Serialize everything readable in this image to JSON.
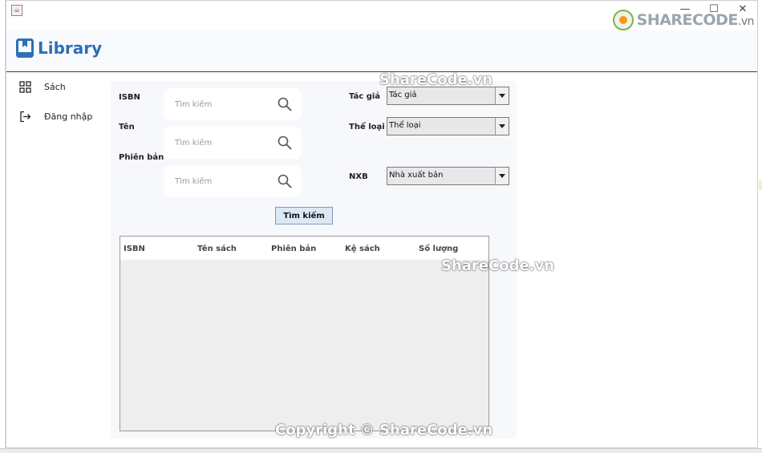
{
  "window": {
    "app_icon_glyph": "☕",
    "controls": {
      "minimize": "—",
      "maximize": "☐",
      "close": "✕"
    }
  },
  "header": {
    "brand_icon": "bookmark-book-icon",
    "title": "Library",
    "accent_color": "#2f6fb5",
    "watermark_logo": {
      "main": "SHARECODE",
      "suffix": ".vn"
    }
  },
  "sidebar": {
    "items": [
      {
        "icon": "grid-icon",
        "label": "Sách"
      },
      {
        "icon": "login-icon",
        "label": "Đăng nhập"
      }
    ]
  },
  "search_form": {
    "isbn_label": "ISBN",
    "name_label": "Tên",
    "edition_label": "Phiên bản",
    "isbn_placeholder": "Tìm kiếm",
    "name_placeholder": "Tìm kiếm",
    "edition_placeholder": "Tìm kiếm",
    "author_label": "Tác giả",
    "author_value": "Tác giả",
    "category_label": "Thể loại",
    "category_value": "Thể loại",
    "publisher_label": "NXB",
    "publisher_value": "Nhà xuất bản",
    "search_button": "Tìm kiếm"
  },
  "table": {
    "columns": [
      "ISBN",
      "Tên sách",
      "Phiên bản",
      "Kệ sách",
      "Số lượng"
    ],
    "rows": []
  },
  "watermarks": {
    "top": "ShareCode.vn",
    "middle": "ShareCode.vn",
    "bottom": "Copyright © ShareCode.vn"
  }
}
